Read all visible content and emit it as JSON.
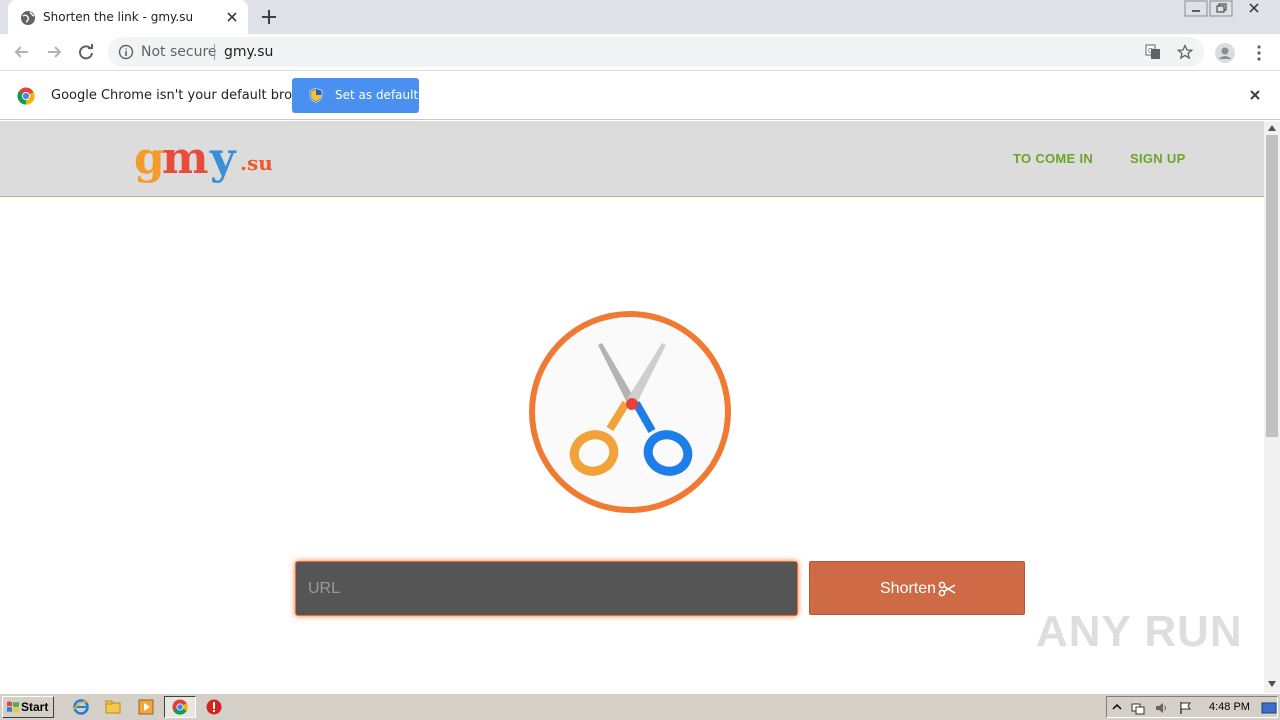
{
  "browser": {
    "tab": {
      "title": "Shorten the link - gmy.su"
    },
    "omnibox": {
      "security": "Not secure",
      "url": "gmy.su"
    },
    "infobar": {
      "message": "Google Chrome isn't your default browser",
      "button": "Set as default"
    }
  },
  "site": {
    "logo": {
      "g": "g",
      "m": "m",
      "y": "y",
      "su": ".su"
    },
    "nav": {
      "login": "TO COME IN",
      "signup": "SIGN UP"
    },
    "form": {
      "url_placeholder": "URL",
      "url_value": "",
      "submit": "Shorten"
    },
    "colors": {
      "accent": "#cf6a47",
      "nav": "#6ca52c",
      "ring": "#f07a32"
    }
  },
  "watermark": "ANY RUN",
  "taskbar": {
    "start": "Start",
    "clock": "4:48 PM"
  }
}
